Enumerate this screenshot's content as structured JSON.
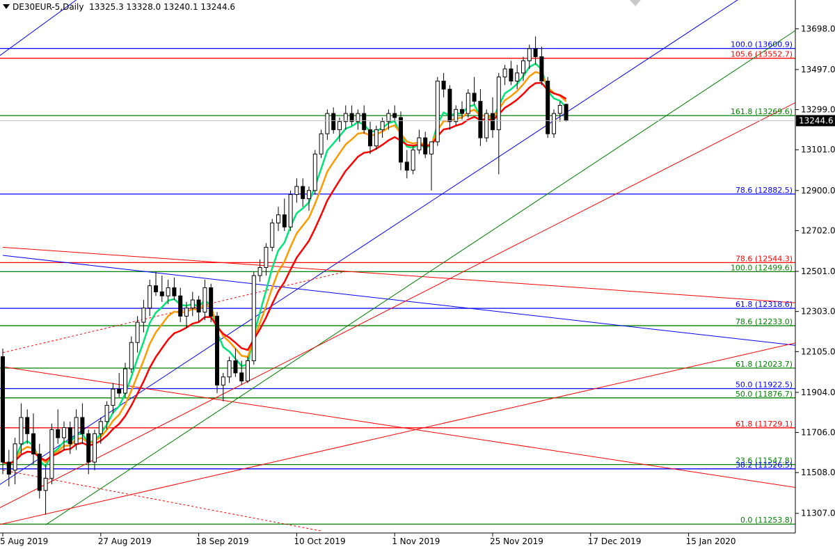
{
  "header": {
    "symbol": "DE30EUR-5,Daily",
    "ohlc": "13325.3 13328.0 13240.1 13244.6"
  },
  "colors": {
    "bull": "#ffffff",
    "bear": "#000000",
    "wick": "#000000",
    "ema_fast": "#00e676",
    "ema_mid": "#ff9900",
    "ema_slow": "#ff0000",
    "fib_blue": "#0000ff",
    "fib_red": "#ff0000",
    "fib_green": "#008000",
    "grid": "#000000",
    "price_tag_bg": "#000000",
    "price_tag_fg": "#ffffff"
  },
  "chart_data": {
    "type": "candlestick",
    "title": "",
    "xlabel": "",
    "ylabel": "",
    "ylim": [
      11210,
      13840
    ],
    "y_ticks": [
      "13698.0",
      "13497.0",
      "13299.0",
      "13101.0",
      "12900.0",
      "12702.0",
      "12501.0",
      "12303.0",
      "12105.0",
      "11904.0",
      "11706.0",
      "11508.0",
      "11307.0"
    ],
    "x_ticks": [
      "5 Aug 2019",
      "27 Aug 2019",
      "18 Sep 2019",
      "10 Oct 2019",
      "1 Nov 2019",
      "25 Nov 2019",
      "17 Dec 2019",
      "15 Jan 2020"
    ],
    "x_tick_bars": [
      0,
      16,
      32,
      48,
      64,
      80,
      96,
      112
    ],
    "last_price": "13244.6",
    "candles": [
      [
        12080,
        12120,
        11500,
        11560
      ],
      [
        11560,
        11620,
        11440,
        11500
      ],
      [
        11520,
        11680,
        11450,
        11650
      ],
      [
        11650,
        11850,
        11600,
        11780
      ],
      [
        11780,
        11820,
        11650,
        11700
      ],
      [
        11700,
        11800,
        11550,
        11600
      ],
      [
        11600,
        11650,
        11380,
        11420
      ],
      [
        11420,
        11550,
        11300,
        11480
      ],
      [
        11480,
        11750,
        11450,
        11720
      ],
      [
        11720,
        11820,
        11650,
        11680
      ],
      [
        11680,
        11760,
        11620,
        11730
      ],
      [
        11730,
        11760,
        11600,
        11650
      ],
      [
        11650,
        11820,
        11620,
        11780
      ],
      [
        11780,
        11850,
        11650,
        11700
      ],
      [
        11700,
        11720,
        11500,
        11560
      ],
      [
        11560,
        11720,
        11520,
        11700
      ],
      [
        11700,
        11780,
        11650,
        11760
      ],
      [
        11760,
        11860,
        11720,
        11840
      ],
      [
        11840,
        11950,
        11800,
        11920
      ],
      [
        11920,
        12000,
        11880,
        11900
      ],
      [
        11900,
        12050,
        11880,
        12020
      ],
      [
        12020,
        12180,
        12000,
        12150
      ],
      [
        12150,
        12280,
        12100,
        12250
      ],
      [
        12250,
        12360,
        12200,
        12320
      ],
      [
        12320,
        12460,
        12280,
        12430
      ],
      [
        12430,
        12500,
        12380,
        12400
      ],
      [
        12400,
        12480,
        12350,
        12380
      ],
      [
        12380,
        12460,
        12340,
        12420
      ],
      [
        12420,
        12470,
        12360,
        12380
      ],
      [
        12380,
        12420,
        12250,
        12280
      ],
      [
        12280,
        12350,
        12220,
        12320
      ],
      [
        12320,
        12400,
        12280,
        12360
      ],
      [
        12360,
        12380,
        12250,
        12300
      ],
      [
        12300,
        12460,
        12260,
        12420
      ],
      [
        12420,
        12440,
        12250,
        12280
      ],
      [
        12280,
        12300,
        11900,
        11940
      ],
      [
        11940,
        12000,
        11860,
        11980
      ],
      [
        11980,
        12080,
        11950,
        12060
      ],
      [
        12060,
        12120,
        11980,
        12000
      ],
      [
        12000,
        12060,
        11940,
        11960
      ],
      [
        11960,
        12080,
        11950,
        12060
      ],
      [
        12060,
        12500,
        12040,
        12480
      ],
      [
        12480,
        12560,
        12450,
        12520
      ],
      [
        12520,
        12640,
        12480,
        12620
      ],
      [
        12620,
        12760,
        12600,
        12740
      ],
      [
        12740,
        12820,
        12700,
        12780
      ],
      [
        12780,
        12860,
        12700,
        12720
      ],
      [
        12720,
        12900,
        12700,
        12880
      ],
      [
        12880,
        12960,
        12840,
        12920
      ],
      [
        12920,
        12960,
        12820,
        12860
      ],
      [
        12860,
        12920,
        12800,
        12900
      ],
      [
        12900,
        13100,
        12880,
        13080
      ],
      [
        13080,
        13200,
        13060,
        13180
      ],
      [
        13180,
        13300,
        13150,
        13280
      ],
      [
        13280,
        13310,
        13180,
        13200
      ],
      [
        13200,
        13260,
        13140,
        13240
      ],
      [
        13240,
        13320,
        13200,
        13280
      ],
      [
        13280,
        13320,
        13220,
        13240
      ],
      [
        13240,
        13300,
        13200,
        13280
      ],
      [
        13280,
        13320,
        13180,
        13200
      ],
      [
        13200,
        13240,
        13080,
        13120
      ],
      [
        13120,
        13220,
        13100,
        13200
      ],
      [
        13200,
        13260,
        13160,
        13240
      ],
      [
        13240,
        13300,
        13200,
        13280
      ],
      [
        13280,
        13320,
        13240,
        13260
      ],
      [
        13260,
        13290,
        13000,
        13040
      ],
      [
        13040,
        13100,
        12960,
        13000
      ],
      [
        13000,
        13120,
        12980,
        13100
      ],
      [
        13100,
        13200,
        13080,
        13160
      ],
      [
        13160,
        13190,
        13060,
        13080
      ],
      [
        13080,
        13120,
        12900,
        13140
      ],
      [
        13140,
        13460,
        13120,
        13440
      ],
      [
        13440,
        13480,
        13360,
        13400
      ],
      [
        13400,
        13420,
        13200,
        13240
      ],
      [
        13240,
        13320,
        13220,
        13300
      ],
      [
        13300,
        13340,
        13250,
        13280
      ],
      [
        13280,
        13400,
        13260,
        13380
      ],
      [
        13380,
        13460,
        13320,
        13340
      ],
      [
        13340,
        13400,
        13120,
        13160
      ],
      [
        13160,
        13300,
        13140,
        13280
      ],
      [
        13280,
        13360,
        13160,
        13200
      ],
      [
        13200,
        13480,
        12980,
        13460
      ],
      [
        13460,
        13520,
        13420,
        13500
      ],
      [
        13500,
        13540,
        13420,
        13440
      ],
      [
        13440,
        13520,
        13400,
        13480
      ],
      [
        13480,
        13560,
        13440,
        13540
      ],
      [
        13540,
        13620,
        13500,
        13600
      ],
      [
        13600,
        13660,
        13520,
        13560
      ],
      [
        13560,
        13610,
        13420,
        13440
      ],
      [
        13440,
        13460,
        13160,
        13180
      ],
      [
        13180,
        13300,
        13160,
        13280
      ],
      [
        13280,
        13340,
        13240,
        13320
      ],
      [
        13325.3,
        13328.0,
        13240.1,
        13244.6
      ]
    ],
    "fib_levels": [
      {
        "label": "100.0 (13600.9)",
        "value": 13600.9,
        "color": "blue"
      },
      {
        "label": "105.6 (13552.7)",
        "value": 13552.7,
        "color": "red"
      },
      {
        "label": "161.8 (13269.6)",
        "value": 13269.6,
        "color": "green"
      },
      {
        "label": "78.6 (12882.5)",
        "value": 12882.5,
        "color": "blue"
      },
      {
        "label": "78.6 (12544.3)",
        "value": 12544.3,
        "color": "red"
      },
      {
        "label": "100.0 (12499.6)",
        "value": 12499.6,
        "color": "green"
      },
      {
        "label": "61.8 (12318.6)",
        "value": 12318.6,
        "color": "blue"
      },
      {
        "label": "78.6 (12233.0)",
        "value": 12233.0,
        "color": "green"
      },
      {
        "label": "61.8 (12023.7)",
        "value": 12023.7,
        "color": "green"
      },
      {
        "label": "50.0 (11922.5)",
        "value": 11922.5,
        "color": "blue"
      },
      {
        "label": "50.0 (11876.7)",
        "value": 11876.7,
        "color": "green"
      },
      {
        "label": "61.8 (11729.1)",
        "value": 11729.1,
        "color": "red"
      },
      {
        "label": "23.6 (11547.8)",
        "value": 11547.8,
        "color": "green"
      },
      {
        "label": "38.2 (11526.5)",
        "value": 11526.5,
        "color": "blue"
      },
      {
        "label": "0.0 (11253.8)",
        "value": 11253.8,
        "color": "green"
      }
    ],
    "trendlines": [
      {
        "color": "blue",
        "from": [
          -8,
          11300
        ],
        "to": [
          122,
          13880
        ],
        "dash": false
      },
      {
        "color": "blue",
        "from": [
          0,
          12580
        ],
        "to": [
          137,
          12110
        ],
        "dash": false
      },
      {
        "color": "red",
        "from": [
          0,
          12620
        ],
        "to": [
          137,
          12330
        ],
        "dash": false
      },
      {
        "color": "red",
        "from": [
          0,
          12030
        ],
        "to": [
          137,
          11400
        ],
        "dash": false
      },
      {
        "color": "green",
        "from": [
          7,
          11250
        ],
        "to": [
          137,
          13840
        ],
        "dash": false
      },
      {
        "color": "red",
        "from": [
          -6,
          11250
        ],
        "to": [
          137,
          13450
        ],
        "dash": false
      },
      {
        "color": "red",
        "from": [
          -8,
          11200
        ],
        "to": [
          137,
          12200
        ],
        "dash": false
      },
      {
        "color": "blue",
        "from": [
          -8,
          13400
        ],
        "to": [
          12,
          13840
        ],
        "dash": false
      },
      {
        "color": "red",
        "from": [
          0,
          12100
        ],
        "to": [
          56,
          12500
        ],
        "dash": true
      },
      {
        "color": "red",
        "from": [
          0,
          11520
        ],
        "to": [
          52,
          11220
        ],
        "dash": true
      }
    ]
  }
}
